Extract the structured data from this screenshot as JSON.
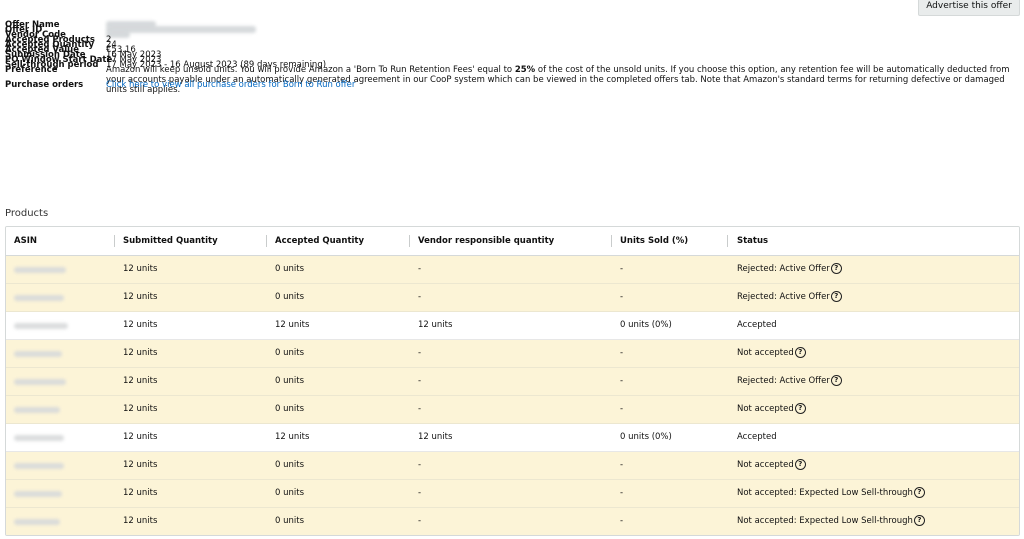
{
  "header": {
    "advertise_label": "Advertise this offer"
  },
  "details": {
    "offer_name_label": "Offer Name",
    "offer_id_label": "Offer ID",
    "vendor_code_label": "Vendor Code",
    "accepted_products_label": "Accepted Products",
    "accepted_products": "2",
    "accepted_quantity_label": "Accepted Quantity",
    "accepted_quantity": "24",
    "accepted_value_label": "Accepted Value",
    "accepted_value": "€53.16",
    "submission_date_label": "Submission Date",
    "submission_date": "16 May 2023",
    "po_window_label": "PO Window Start Date",
    "po_window": "17 May 2023",
    "sell_through_label": "Sell-through period",
    "sell_through": "17 May 2023 - 16 August 2023 (89 days remaining)",
    "preference_label": "Preference",
    "preference_pre": "Amazon will keep unsold units. You will provide Amazon a 'Born To Run Retention Fees' equal to ",
    "preference_bold": "25%",
    "preference_post": " of the cost of the unsold units. If you choose this option, any retention fee will be automatically deducted from your accounts payable under an automatically generated agreement in our CooP system which can be viewed in the completed offers tab. Note that Amazon's standard terms for returning defective or damaged units still applies.",
    "purchase_orders_label": "Purchase orders",
    "purchase_orders_link": "Click here to view all purchase orders for Born to Run offer"
  },
  "products": {
    "section_title": "Products",
    "columns": {
      "asin": "ASIN",
      "submitted": "Submitted Quantity",
      "accepted": "Accepted Quantity",
      "vendor_resp": "Vendor responsible quantity",
      "units_sold": "Units Sold (%)",
      "status": "Status"
    },
    "help_icon": "?",
    "rows": [
      {
        "submitted": "12 units",
        "accepted": "0 units",
        "vendor": "-",
        "sold": "-",
        "status": "Rejected: Active Offer",
        "help": true,
        "state": "warn"
      },
      {
        "submitted": "12 units",
        "accepted": "0 units",
        "vendor": "-",
        "sold": "-",
        "status": "Rejected: Active Offer",
        "help": true,
        "state": "warn"
      },
      {
        "submitted": "12 units",
        "accepted": "12 units",
        "vendor": "12 units",
        "sold": "0 units (0%)",
        "status": "Accepted",
        "help": false,
        "state": "ok"
      },
      {
        "submitted": "12 units",
        "accepted": "0 units",
        "vendor": "-",
        "sold": "-",
        "status": "Not accepted",
        "help": true,
        "state": "warn"
      },
      {
        "submitted": "12 units",
        "accepted": "0 units",
        "vendor": "-",
        "sold": "-",
        "status": "Rejected: Active Offer",
        "help": true,
        "state": "warn"
      },
      {
        "submitted": "12 units",
        "accepted": "0 units",
        "vendor": "-",
        "sold": "-",
        "status": "Not accepted",
        "help": true,
        "state": "warn"
      },
      {
        "submitted": "12 units",
        "accepted": "12 units",
        "vendor": "12 units",
        "sold": "0 units (0%)",
        "status": "Accepted",
        "help": false,
        "state": "ok"
      },
      {
        "submitted": "12 units",
        "accepted": "0 units",
        "vendor": "-",
        "sold": "-",
        "status": "Not accepted",
        "help": true,
        "state": "warn"
      },
      {
        "submitted": "12 units",
        "accepted": "0 units",
        "vendor": "-",
        "sold": "-",
        "status": "Not accepted: Expected Low Sell-through",
        "help": true,
        "state": "warn"
      },
      {
        "submitted": "12 units",
        "accepted": "0 units",
        "vendor": "-",
        "sold": "-",
        "status": "Not accepted: Expected Low Sell-through",
        "help": true,
        "state": "warn"
      }
    ]
  },
  "colors": {
    "warn_row": "#fcf4d7",
    "ok_row": "#ffffff",
    "link": "#0066c0",
    "button_bg": "#e9ecec"
  }
}
